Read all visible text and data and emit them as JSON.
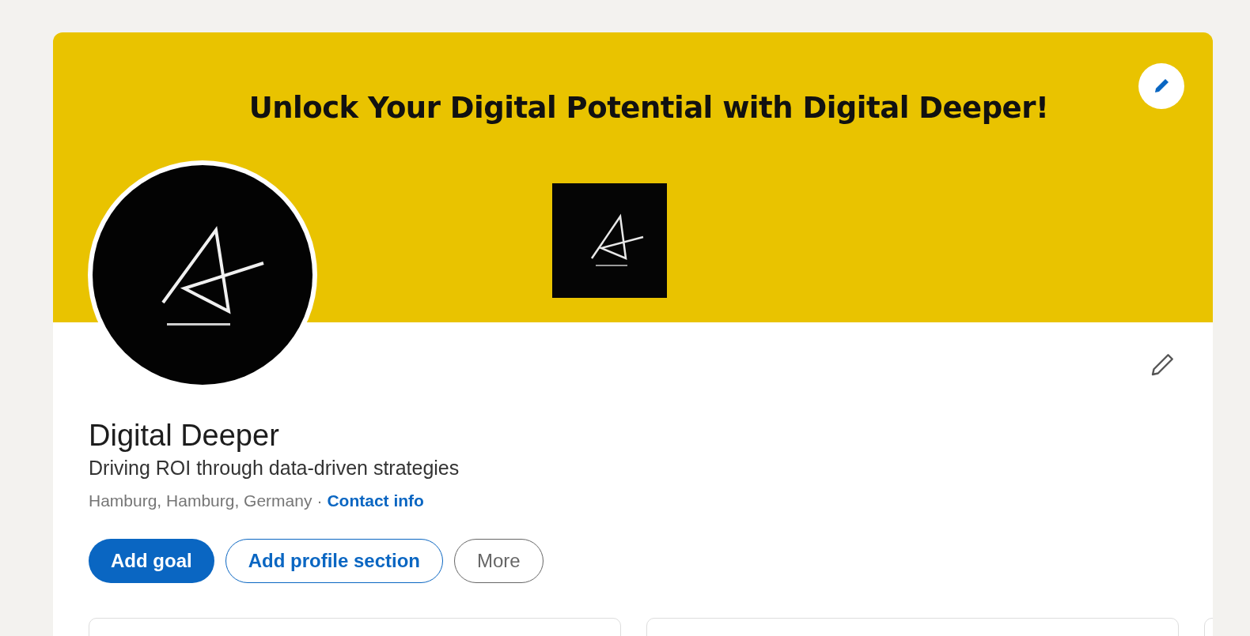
{
  "banner": {
    "headline": "Unlock Your Digital Potential with Digital Deeper!"
  },
  "profile": {
    "name": "Digital Deeper",
    "headline": "Driving ROI through data-driven strategies",
    "location": "Hamburg, Hamburg, Germany",
    "separator": "·",
    "contact_link": "Contact info"
  },
  "buttons": [
    {
      "label": "Add goal",
      "kind": "primary"
    },
    {
      "label": "Add profile section",
      "kind": "secondary"
    },
    {
      "label": "More",
      "kind": "tertiary"
    }
  ]
}
